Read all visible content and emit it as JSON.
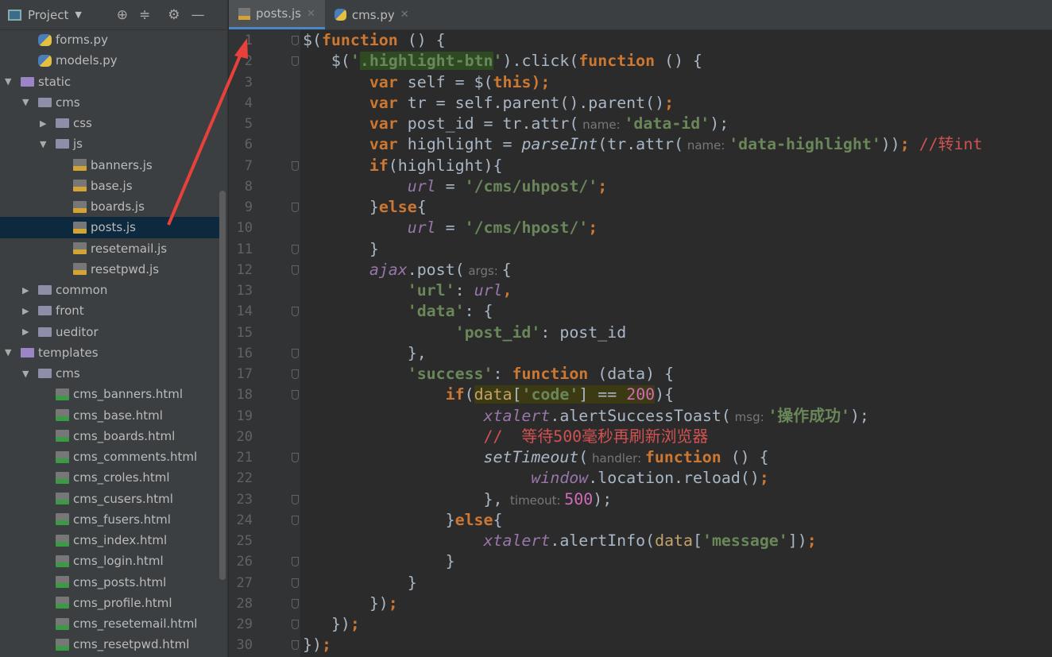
{
  "sidebar": {
    "title": "Project",
    "items": [
      {
        "label": "forms.py",
        "level": 2,
        "type": "py"
      },
      {
        "label": "models.py",
        "level": 2,
        "type": "py"
      },
      {
        "label": "static",
        "level": 1,
        "type": "folder-purple",
        "expanded": true
      },
      {
        "label": "cms",
        "level": 2,
        "type": "folder",
        "expanded": true
      },
      {
        "label": "css",
        "level": 3,
        "type": "folder",
        "expanded": false
      },
      {
        "label": "js",
        "level": 3,
        "type": "folder",
        "expanded": true
      },
      {
        "label": "banners.js",
        "level": 4,
        "type": "js"
      },
      {
        "label": "base.js",
        "level": 4,
        "type": "js"
      },
      {
        "label": "boards.js",
        "level": 4,
        "type": "js"
      },
      {
        "label": "posts.js",
        "level": 4,
        "type": "js",
        "selected": true
      },
      {
        "label": "resetemail.js",
        "level": 4,
        "type": "js"
      },
      {
        "label": "resetpwd.js",
        "level": 4,
        "type": "js"
      },
      {
        "label": "common",
        "level": 2,
        "type": "folder",
        "expanded": false
      },
      {
        "label": "front",
        "level": 2,
        "type": "folder",
        "expanded": false
      },
      {
        "label": "ueditor",
        "level": 2,
        "type": "folder",
        "expanded": false
      },
      {
        "label": "templates",
        "level": 1,
        "type": "folder-purple",
        "expanded": true
      },
      {
        "label": "cms",
        "level": 2,
        "type": "folder",
        "expanded": true
      },
      {
        "label": "cms_banners.html",
        "level": 3,
        "type": "html"
      },
      {
        "label": "cms_base.html",
        "level": 3,
        "type": "html"
      },
      {
        "label": "cms_boards.html",
        "level": 3,
        "type": "html"
      },
      {
        "label": "cms_comments.html",
        "level": 3,
        "type": "html"
      },
      {
        "label": "cms_croles.html",
        "level": 3,
        "type": "html"
      },
      {
        "label": "cms_cusers.html",
        "level": 3,
        "type": "html"
      },
      {
        "label": "cms_fusers.html",
        "level": 3,
        "type": "html"
      },
      {
        "label": "cms_index.html",
        "level": 3,
        "type": "html"
      },
      {
        "label": "cms_login.html",
        "level": 3,
        "type": "html"
      },
      {
        "label": "cms_posts.html",
        "level": 3,
        "type": "html"
      },
      {
        "label": "cms_profile.html",
        "level": 3,
        "type": "html"
      },
      {
        "label": "cms_resetemail.html",
        "level": 3,
        "type": "html"
      },
      {
        "label": "cms_resetpwd.html",
        "level": 3,
        "type": "html"
      }
    ]
  },
  "tabs": [
    {
      "label": "posts.js",
      "type": "js",
      "active": true
    },
    {
      "label": "cms.py",
      "type": "py",
      "active": false
    }
  ],
  "colors": {
    "annotation_arrow": "#e8413c",
    "accent": "#4a88c7"
  },
  "code": [
    [
      [
        "$(",
        "d"
      ],
      [
        "function",
        "kw"
      ],
      [
        " () {",
        "d"
      ]
    ],
    [
      [
        "   $(",
        "d"
      ],
      [
        "'",
        "str"
      ],
      [
        ".highlight-btn",
        "str hls"
      ],
      [
        "'",
        "str"
      ],
      [
        ").click(",
        "d"
      ],
      [
        "function",
        "kw"
      ],
      [
        " () {",
        "d"
      ]
    ],
    [
      [
        "       ",
        "d"
      ],
      [
        "var",
        "kw"
      ],
      [
        " self = $(",
        "d"
      ],
      [
        "this",
        "kw"
      ],
      [
        ");",
        "kw"
      ]
    ],
    [
      [
        "       ",
        "d"
      ],
      [
        "var",
        "kw"
      ],
      [
        " tr = self.parent().parent()",
        "d"
      ],
      [
        ";",
        "kw"
      ]
    ],
    [
      [
        "       ",
        "d"
      ],
      [
        "var",
        "kw"
      ],
      [
        " post_id = tr.attr(",
        "d"
      ],
      [
        " name: ",
        "hint"
      ],
      [
        "'data-id'",
        "str"
      ],
      [
        ");",
        "d"
      ]
    ],
    [
      [
        "       ",
        "d"
      ],
      [
        "var",
        "kw"
      ],
      [
        " highlight = ",
        "d"
      ],
      [
        "parseInt",
        "it"
      ],
      [
        "(tr.attr(",
        "d"
      ],
      [
        " name: ",
        "hint"
      ],
      [
        "'data-highlight'",
        "str"
      ],
      [
        "))",
        "d"
      ],
      [
        ";",
        "kw"
      ],
      [
        " //转int",
        "cm"
      ]
    ],
    [
      [
        "       ",
        "d"
      ],
      [
        "if",
        "kw"
      ],
      [
        "(highlight){",
        "d"
      ]
    ],
    [
      [
        "           ",
        "d"
      ],
      [
        "url",
        "fn"
      ],
      [
        " = ",
        "d"
      ],
      [
        "'/cms/uhpost/'",
        "str"
      ],
      [
        ";",
        "kw"
      ]
    ],
    [
      [
        "       }",
        "d"
      ],
      [
        "else",
        "kw"
      ],
      [
        "{",
        "d"
      ]
    ],
    [
      [
        "           ",
        "d"
      ],
      [
        "url",
        "fn"
      ],
      [
        " = ",
        "d"
      ],
      [
        "'/cms/hpost/'",
        "str"
      ],
      [
        ";",
        "kw"
      ]
    ],
    [
      [
        "       }",
        "d"
      ]
    ],
    [
      [
        "       ",
        "d"
      ],
      [
        "ajax",
        "fn"
      ],
      [
        ".post(",
        "d"
      ],
      [
        " args: ",
        "hint"
      ],
      [
        "{",
        "d"
      ]
    ],
    [
      [
        "           ",
        "d"
      ],
      [
        "'url'",
        "str"
      ],
      [
        ": ",
        "d"
      ],
      [
        "url",
        "fn"
      ],
      [
        ",",
        "kw"
      ]
    ],
    [
      [
        "           ",
        "d"
      ],
      [
        "'data'",
        "str"
      ],
      [
        ": {",
        "d"
      ]
    ],
    [
      [
        "                ",
        "d"
      ],
      [
        "'post_id'",
        "str"
      ],
      [
        ": post_id",
        "d"
      ]
    ],
    [
      [
        "           },",
        "d"
      ]
    ],
    [
      [
        "           ",
        "d"
      ],
      [
        "'success'",
        "str"
      ],
      [
        ": ",
        "d"
      ],
      [
        "function",
        "kw"
      ],
      [
        " (data) {",
        "d"
      ]
    ],
    [
      [
        "               ",
        "d"
      ],
      [
        "if",
        "kw"
      ],
      [
        "(",
        "d"
      ],
      [
        "data",
        "fld hl"
      ],
      [
        "[",
        "d hl"
      ],
      [
        "'code'",
        "str hl"
      ],
      [
        "] == ",
        "d hl"
      ],
      [
        "200",
        "num hl"
      ],
      [
        "){",
        "d"
      ]
    ],
    [
      [
        "                   ",
        "d"
      ],
      [
        "xtalert",
        "fn"
      ],
      [
        ".alertSuccessToast(",
        "d"
      ],
      [
        " msg: ",
        "hint"
      ],
      [
        "'操作成功'",
        "str"
      ],
      [
        ");",
        "d"
      ]
    ],
    [
      [
        "                   ",
        "d"
      ],
      [
        "//  等待500毫秒再刷新浏览器",
        "cm"
      ]
    ],
    [
      [
        "                   ",
        "d"
      ],
      [
        "setTimeout",
        "it"
      ],
      [
        "(",
        "d"
      ],
      [
        " handler: ",
        "hint"
      ],
      [
        "function",
        "kw"
      ],
      [
        " () {",
        "d"
      ]
    ],
    [
      [
        "                        ",
        "d"
      ],
      [
        "window",
        "fn"
      ],
      [
        ".location.reload()",
        "d"
      ],
      [
        ";",
        "kw"
      ]
    ],
    [
      [
        "                   },",
        "d"
      ],
      [
        "  timeout: ",
        "hint"
      ],
      [
        "500",
        "num"
      ],
      [
        ");",
        "d"
      ]
    ],
    [
      [
        "               }",
        "d"
      ],
      [
        "else",
        "kw"
      ],
      [
        "{",
        "d"
      ]
    ],
    [
      [
        "                   ",
        "d"
      ],
      [
        "xtalert",
        "fn"
      ],
      [
        ".alertInfo(",
        "d"
      ],
      [
        "data",
        "fld"
      ],
      [
        "[",
        "d"
      ],
      [
        "'message'",
        "str"
      ],
      [
        "])",
        "d"
      ],
      [
        ";",
        "kw"
      ]
    ],
    [
      [
        "               }",
        "d"
      ]
    ],
    [
      [
        "           }",
        "d"
      ]
    ],
    [
      [
        "       })",
        "d"
      ],
      [
        ";",
        "kw"
      ]
    ],
    [
      [
        "   })",
        "d"
      ],
      [
        ";",
        "kw"
      ]
    ],
    [
      [
        "})",
        "d"
      ],
      [
        ";",
        "kw"
      ]
    ]
  ]
}
